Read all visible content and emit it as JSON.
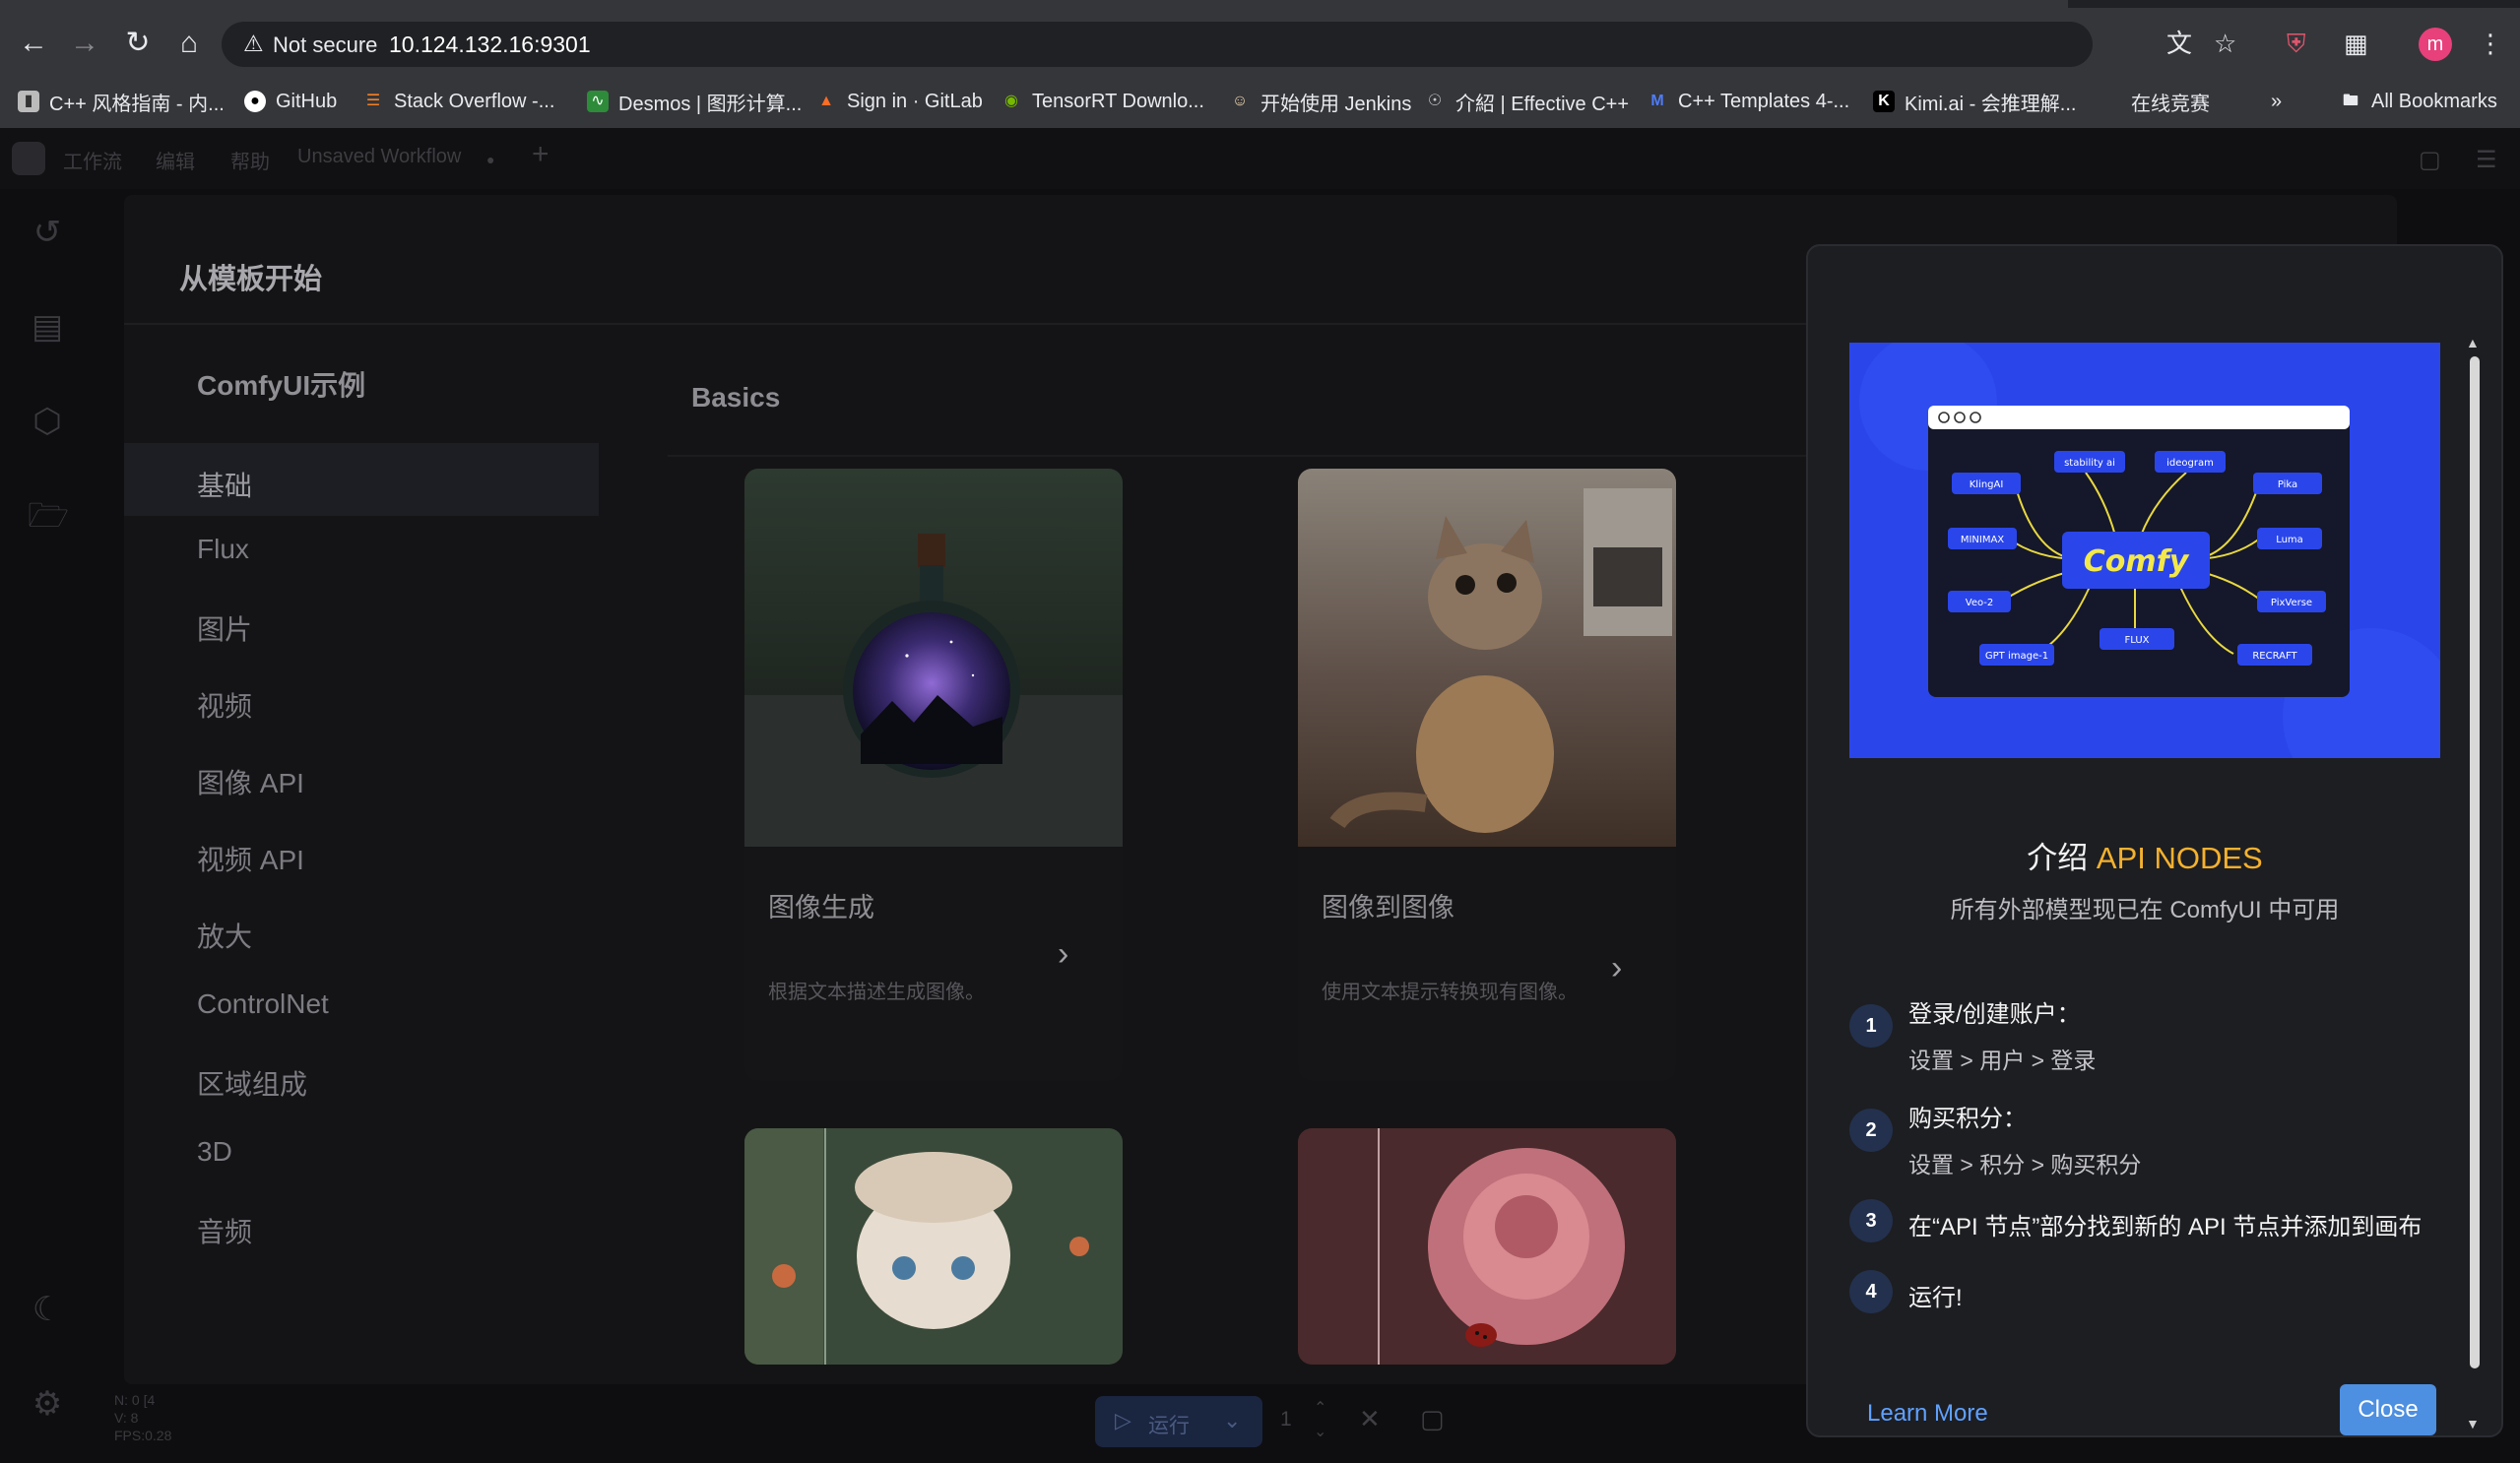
{
  "browser": {
    "security_label": "Not secure",
    "url": "10.124.132.16:9301",
    "avatar_letter": "m",
    "bookmarks": [
      "C++ 风格指南 - 内...",
      "GitHub",
      "Stack Overflow -...",
      "Desmos | 图形计算...",
      "Sign in · GitLab",
      "TensorRT Downlo...",
      "开始使用 Jenkins",
      "介紹 | Effective C++",
      "C++ Templates 4-...",
      "Kimi.ai - 会推理解...",
      "在线竞赛"
    ],
    "all_bookmarks": "All Bookmarks"
  },
  "app": {
    "menu": [
      "工作流",
      "编辑",
      "帮助"
    ],
    "workflow_tab": "Unsaved Workflow",
    "bottom": {
      "run_label": "运行",
      "batch_count": "1",
      "fps_lines": [
        "N: 0 [4",
        "V: 8",
        "FPS:0.28"
      ]
    }
  },
  "templates": {
    "title": "从模板开始",
    "left_title": "ComfyUI示例",
    "categories": [
      "基础",
      "Flux",
      "图片",
      "视频",
      "图像 API",
      "视频 API",
      "放大",
      "ControlNet",
      "区域组成",
      "3D",
      "音频"
    ],
    "section_title": "Basics",
    "cards": [
      {
        "title": "图像生成",
        "desc": "根据文本描述生成图像。"
      },
      {
        "title": "图像到图像",
        "desc": "使用文本提示转换现有图像。"
      },
      {
        "title": "",
        "desc": ""
      },
      {
        "title": "",
        "desc": ""
      }
    ]
  },
  "popup": {
    "heading_prefix": "介绍 ",
    "heading_accent": "API NODES",
    "subtitle": "所有外部模型现已在 ComfyUI 中可用",
    "banner": {
      "center_logo": "Comfy",
      "providers": [
        "stability ai",
        "ideogram",
        "KlingAI",
        "Pika",
        "MINIMAX",
        "Luma",
        "Veo-2",
        "PixVerse",
        "FLUX",
        "GPT image-1",
        "RECRAFT"
      ]
    },
    "steps": [
      {
        "num": "1",
        "title": "登录/创建账户：",
        "sub": "设置 > 用户 > 登录"
      },
      {
        "num": "2",
        "title": "购买积分：",
        "sub": "设置 > 积分 > 购买积分"
      },
      {
        "num": "3",
        "title": "在“API 节点”部分找到新的 API 节点并添加到画布",
        "sub": ""
      },
      {
        "num": "4",
        "title": "运行!",
        "sub": ""
      }
    ],
    "learn_more": "Learn More",
    "close": "Close"
  },
  "colors": {
    "accent": "#f5b12e",
    "banner_blue": "#2a46ea",
    "close_button": "#4d8fe0",
    "link": "#5fa1ff"
  }
}
